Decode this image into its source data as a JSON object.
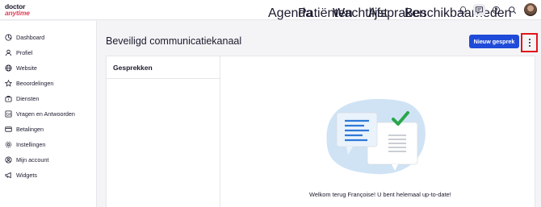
{
  "brand": {
    "line1": "doctor",
    "line2": "anytime",
    "accent": "#e3405a"
  },
  "nav": {
    "items": [
      "Agenda",
      "Patiënten",
      "Wachtlijst",
      "Afspraken",
      "Beschikbaarheden"
    ]
  },
  "topbar_icons": [
    "bell-icon",
    "chat-icon",
    "help-icon",
    "search-icon",
    "avatar"
  ],
  "sidebar": {
    "items": [
      {
        "label": "Dashboard",
        "icon": "dashboard-icon"
      },
      {
        "label": "Profiel",
        "icon": "user-icon"
      },
      {
        "label": "Website",
        "icon": "globe-icon"
      },
      {
        "label": "Beoordelingen",
        "icon": "star-icon"
      },
      {
        "label": "Diensten",
        "icon": "briefcase-icon"
      },
      {
        "label": "Vragen en Antwoorden",
        "icon": "qa-icon"
      },
      {
        "label": "Betalingen",
        "icon": "card-icon"
      },
      {
        "label": "Instellingen",
        "icon": "gear-icon"
      },
      {
        "label": "Mijn account",
        "icon": "account-icon"
      },
      {
        "label": "Widgets",
        "icon": "megaphone-icon"
      }
    ]
  },
  "main": {
    "title": "Beveiligd communicatiekanaal",
    "new_button": "Nieuw gesprek",
    "conversations_title": "Gesprekken",
    "empty_message": "Welkom terug Françoise! U bent helemaal up-to-date!"
  },
  "colors": {
    "primary": "#1f4bd8",
    "highlight_border": "#e0161b",
    "check": "#2aa64a"
  }
}
